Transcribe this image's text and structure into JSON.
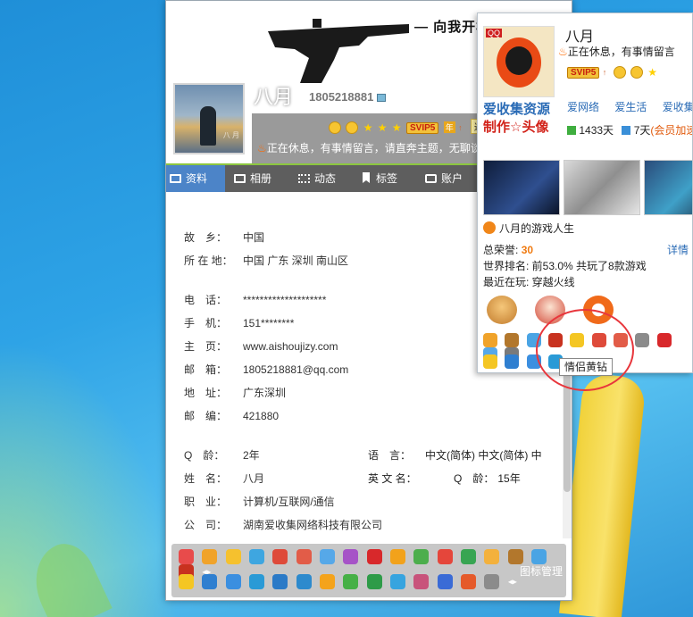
{
  "profile": {
    "banner_text": "向我开枪",
    "nickname": "八月",
    "qq_number": "1805218881",
    "svip": "SVIP5",
    "year_badge": "年",
    "daren": "达人",
    "status": "正在休息，有事情留言，请直奔主题，无聊谈"
  },
  "tabs": [
    {
      "label": "资料"
    },
    {
      "label": "相册"
    },
    {
      "label": "动态"
    },
    {
      "label": "标签"
    },
    {
      "label": "账户"
    }
  ],
  "info": {
    "hometown": {
      "label": "故　乡：",
      "value": "中国"
    },
    "location": {
      "label": "所 在 地：",
      "value": "中国 广东 深圳 南山区"
    },
    "phone": {
      "label": "电　话：",
      "value": "********************"
    },
    "mobile": {
      "label": "手　机：",
      "value": "151********"
    },
    "homepage": {
      "label": "主　页：",
      "value": "www.aishoujizy.com"
    },
    "email": {
      "label": "邮　箱：",
      "value": "1805218881@qq.com"
    },
    "address": {
      "label": "地　址：",
      "value": "广东深圳"
    },
    "zip": {
      "label": "邮　编：",
      "value": "421880"
    },
    "qage": {
      "label": "Q　龄：",
      "value": "2年"
    },
    "language": {
      "label": "语　言：",
      "value": "中文(简体)  中文(简体)  中"
    },
    "name": {
      "label": "姓　名：",
      "value": "八月"
    },
    "english_name": {
      "label": "英 文 名：",
      "value": ""
    },
    "qage2": {
      "label": "Q　龄：",
      "value": "15年"
    },
    "job": {
      "label": "职　业：",
      "value": "计算机/互联网/通信"
    },
    "company": {
      "label": "公　司：",
      "value": "湖南爱收集网络科技有限公司"
    }
  },
  "iconbar": {
    "manage_label": "图标管理"
  },
  "card": {
    "nickname": "八月",
    "banner_text": "向我开枪",
    "status": "正在休息，有事情留言",
    "svip": "SVIP5",
    "links": [
      "爱网络",
      "爱生活",
      "爱收集"
    ],
    "online_days": "1433天",
    "member_days": "7天",
    "member_accel": "(会员加速",
    "badge_line1": "爱收集资源",
    "badge_line2": "制作☆头像",
    "avatar_tag": "QQ",
    "game_title": "八月的游戏人生",
    "honor_label": "总荣誉:",
    "honor_value": "30",
    "detail_link": "详情",
    "rank": "世界排名:  前53.0%  共玩了8款游戏",
    "recent": "最近在玩:  穿越火线",
    "tooltip": "情侣黄钻"
  },
  "colors": {
    "tab_active": "#4c84c8",
    "tab_bar": "#5e5e5e",
    "accent_green": "#8cc63f",
    "honor_orange": "#f07b12",
    "link_blue": "#2b6cb6",
    "highlight_circle": "#e8363c"
  }
}
